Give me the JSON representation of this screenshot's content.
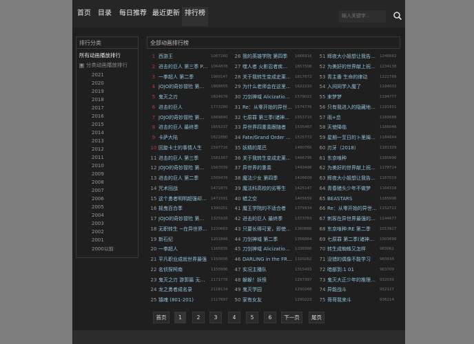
{
  "nav": {
    "items": [
      "首页",
      "目录",
      "每日推荐",
      "最近更新",
      "排行榜"
    ],
    "active": "排行榜",
    "search_placeholder": "输入关键字..."
  },
  "sidebar": {
    "title": "排行分类",
    "all": "所有动画播放排行",
    "category": "分类动画播放排行",
    "years": [
      "2021",
      "2020",
      "2019",
      "2018",
      "2017",
      "2016",
      "2015",
      "2014",
      "2013",
      "2012",
      "2011",
      "2010",
      "2009",
      "2008",
      "2007",
      "2006",
      "2005",
      "2004",
      "2003",
      "2002",
      "2001",
      "2000以前"
    ]
  },
  "main": {
    "title": "全部动画排行榜",
    "columns": [
      [
        [
          "1",
          "西游王",
          "1067260"
        ],
        [
          "2",
          "进击的巨人 第三季 Part.2",
          "1064878"
        ],
        [
          "3",
          "一拳超人 第二季",
          "1960147"
        ],
        [
          "4",
          "JOJO的奇妙冒险 第三部",
          "1868855"
        ],
        [
          "5",
          "鬼灭之刃",
          "1824678"
        ],
        [
          "6",
          "进击的巨人",
          "1773280"
        ],
        [
          "7",
          "JOJO的奇妙冒险 第一部",
          "1669840"
        ],
        [
          "8",
          "进击的巨人 最终季",
          "1655237"
        ],
        [
          "9",
          "卡萨大陆",
          "1621880"
        ],
        [
          "10",
          "回旋卡士的事情人生",
          "1597716"
        ],
        [
          "11",
          "进击的巨人 第三季",
          "1581367"
        ],
        [
          "12",
          "JOJO的奇妙冒险 第四部",
          "1567039"
        ],
        [
          "13",
          "进击的巨人 第二季",
          "1509478"
        ],
        [
          "14",
          "咒术回战",
          "1471875"
        ],
        [
          "15",
          "这个勇者明明超强却过分慎重",
          "1471591"
        ],
        [
          "16",
          "摇曳百合季",
          "1390201"
        ],
        [
          "17",
          "JOJO的奇妙冒险 第五部",
          "1325928"
        ],
        [
          "18",
          "无职转生 ~在异世界认真地活下去~",
          "1220683"
        ],
        [
          "19",
          "新石纪",
          "1201848"
        ],
        [
          "20",
          "一拳超人",
          "1165835"
        ],
        [
          "21",
          "平凡职业成就世界最强",
          "1150006"
        ],
        [
          "22",
          "名侦探柯南",
          "1150996"
        ],
        [
          "23",
          "鬼灭之刃 游郭篇 无限列车",
          "2171778"
        ],
        [
          "24",
          "龙之勇者成名录",
          "2118134"
        ],
        [
          "25",
          "镇魂 (801-201)",
          "2117697"
        ]
      ],
      [
        [
          "26",
          "我的英雄学院 第四季",
          "1666916"
        ],
        [
          "27",
          "噬人者 火影忍者疾风传",
          "1657508"
        ],
        [
          "28",
          "关于我转生变成史莱姆这档事",
          "1617672"
        ],
        [
          "29",
          "为什么老师会在这里！？",
          "1622210"
        ],
        [
          "30",
          "刀剑神域 Alicization War",
          "1579022"
        ],
        [
          "31",
          "Re：从零开始的异世界生活",
          "1574776"
        ],
        [
          "32",
          "七原罪 第三季(诸神的逆鳞)",
          "1553710"
        ],
        [
          "33",
          "异世界四重奏跟随者",
          "1535467"
        ],
        [
          "34",
          "Fate/Grand Order 绝对魔兽战线",
          "1525772"
        ],
        [
          "35",
          "妖精的尾巴",
          "1480766"
        ],
        [
          "36",
          "关于我转生变成史莱姆这档事 第二季",
          "1466795"
        ],
        [
          "37",
          "异世界的重奏",
          "1443498"
        ],
        [
          "38",
          "魔法少女 第四季",
          "1426609"
        ],
        [
          "39",
          "魔法科高校的劣等生",
          "1425147"
        ],
        [
          "40",
          "蜡之空",
          "1405659"
        ],
        [
          "41",
          "魔王学院的不适合者",
          "1379934"
        ],
        [
          "42",
          "进击的巨人 最终季",
          "1373763"
        ],
        [
          "43",
          "只要长得可爱，即使是变态你也会喜欢我吗",
          "1360886"
        ],
        [
          "44",
          "刀剑神域 第二季",
          "1356864"
        ],
        [
          "45",
          "刀剑神域 Alicization篇",
          "1336986"
        ],
        [
          "46",
          "DARLING in the FRANXX",
          "1320262"
        ],
        [
          "47",
          "实况主播队",
          "1315493"
        ],
        [
          "48",
          "躲躲！妖怪",
          "1297397"
        ],
        [
          "49",
          "鬼灭学园",
          "1290268"
        ],
        [
          "50",
          "家有女友",
          "1290223"
        ]
      ],
      [
        [
          "51",
          "辉夜大小姐想让我告白～天才们的恋爱头脑战～",
          "1246882"
        ],
        [
          "52",
          "为美好的世界献上祝福！",
          "1234138"
        ],
        [
          "53",
          "青主番 生命的律动",
          "1222789"
        ],
        [
          "54",
          "入间同学入魔了",
          "1194032"
        ],
        [
          "55",
          "来梦梦",
          "1194777"
        ],
        [
          "56",
          "只有我进入的隐藏地下城",
          "1191651"
        ],
        [
          "57",
          "雨+恋",
          "1189688"
        ],
        [
          "58",
          "天使降临",
          "1186046"
        ],
        [
          "59",
          "星期一至日的卜里姆卡生活",
          "1184644"
        ],
        [
          "60",
          "刃牙（2018）",
          "1181329"
        ],
        [
          "61",
          "东京喰种",
          "1180996"
        ],
        [
          "62",
          "为美好的世界献上祝福！第二季",
          "1178724"
        ],
        [
          "63",
          "辉夜大小姐想让我告白 第二季",
          "1167019"
        ],
        [
          "64",
          "青春猪头少年不做梦",
          "1164318"
        ],
        [
          "65",
          "BEASTARS",
          "1165996"
        ],
        [
          "66",
          "Re：从零开始的异世界生活 第二季",
          "1152722"
        ],
        [
          "67",
          "刺客在异世界最强的暗杀者",
          "1144677"
        ],
        [
          "68",
          "东京喰种:RE 第二季",
          "1013927"
        ],
        [
          "69",
          "七原罪 第二季(诸神的逆鳞)",
          "1003698"
        ],
        [
          "70",
          "转生成蜘蛛又怎样",
          "983062"
        ],
        [
          "71",
          "没错的偶像不能学习",
          "983638"
        ],
        [
          "72",
          "暗部到:1 01",
          "963709"
        ],
        [
          "73",
          "鬼灭大正少年的推理日记",
          "932036"
        ],
        [
          "74",
          "异能战斗",
          "952127"
        ],
        [
          "75",
          "哥哥我来斗",
          "936214"
        ]
      ]
    ]
  },
  "pagination": {
    "items": [
      "首页",
      "1",
      "2",
      "3",
      "4",
      "5",
      "6",
      "下一页",
      "尾页"
    ],
    "current": "1"
  },
  "colors": {
    "rank_top": "#c8343a",
    "title": "#8fc0d8",
    "panel": "#1f1f1f",
    "page_bg": "#7d7d7d"
  }
}
